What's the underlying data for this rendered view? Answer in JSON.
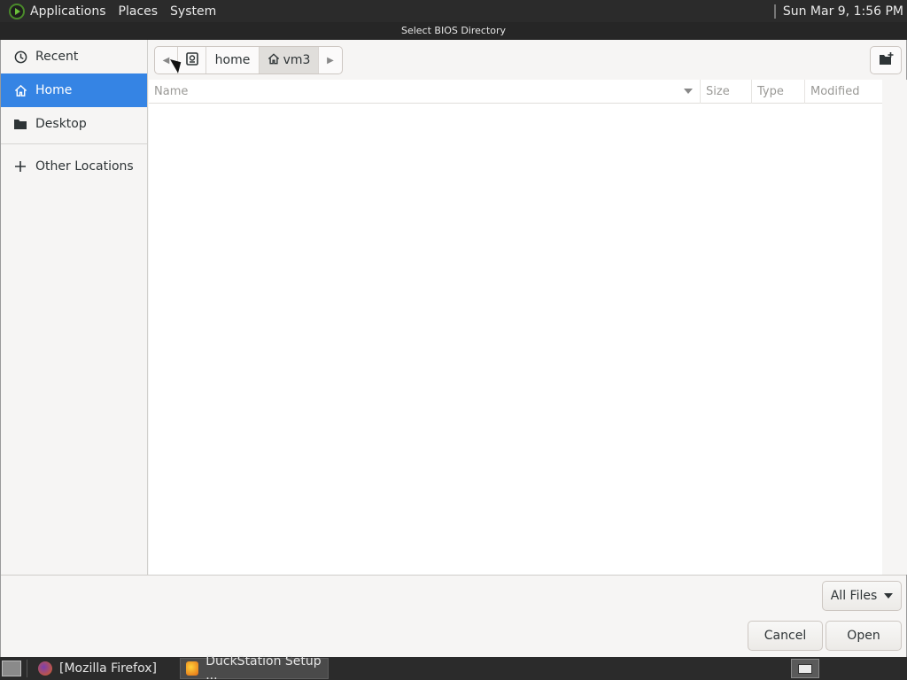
{
  "top_panel": {
    "menus": [
      "Applications",
      "Places",
      "System"
    ],
    "clock": "Sun Mar  9,  1:56 PM"
  },
  "dialog": {
    "title": "Select BIOS Directory"
  },
  "sidebar": {
    "items": [
      {
        "label": "Recent",
        "icon": "clock-icon"
      },
      {
        "label": "Home",
        "icon": "home-icon",
        "active": true
      },
      {
        "label": "Desktop",
        "icon": "folder-icon"
      }
    ],
    "other": {
      "label": "Other Locations",
      "icon": "plus-icon"
    }
  },
  "pathbar": {
    "segments": [
      "home",
      "vm3"
    ],
    "current": "vm3"
  },
  "filelist": {
    "columns": [
      "Name",
      "Size",
      "Type",
      "Modified"
    ],
    "rows": []
  },
  "filter": {
    "selected": "All Files"
  },
  "buttons": {
    "cancel": "Cancel",
    "open": "Open"
  },
  "taskbar": {
    "tasks": [
      {
        "label": "[Mozilla Firefox]",
        "icon": "firefox-icon"
      },
      {
        "label": "DuckStation Setup ...",
        "icon": "duckstation-icon",
        "active": true
      }
    ]
  },
  "colors": {
    "accent": "#3584e4",
    "panel": "#2b2b2b",
    "dialog_bg": "#f6f5f4"
  }
}
